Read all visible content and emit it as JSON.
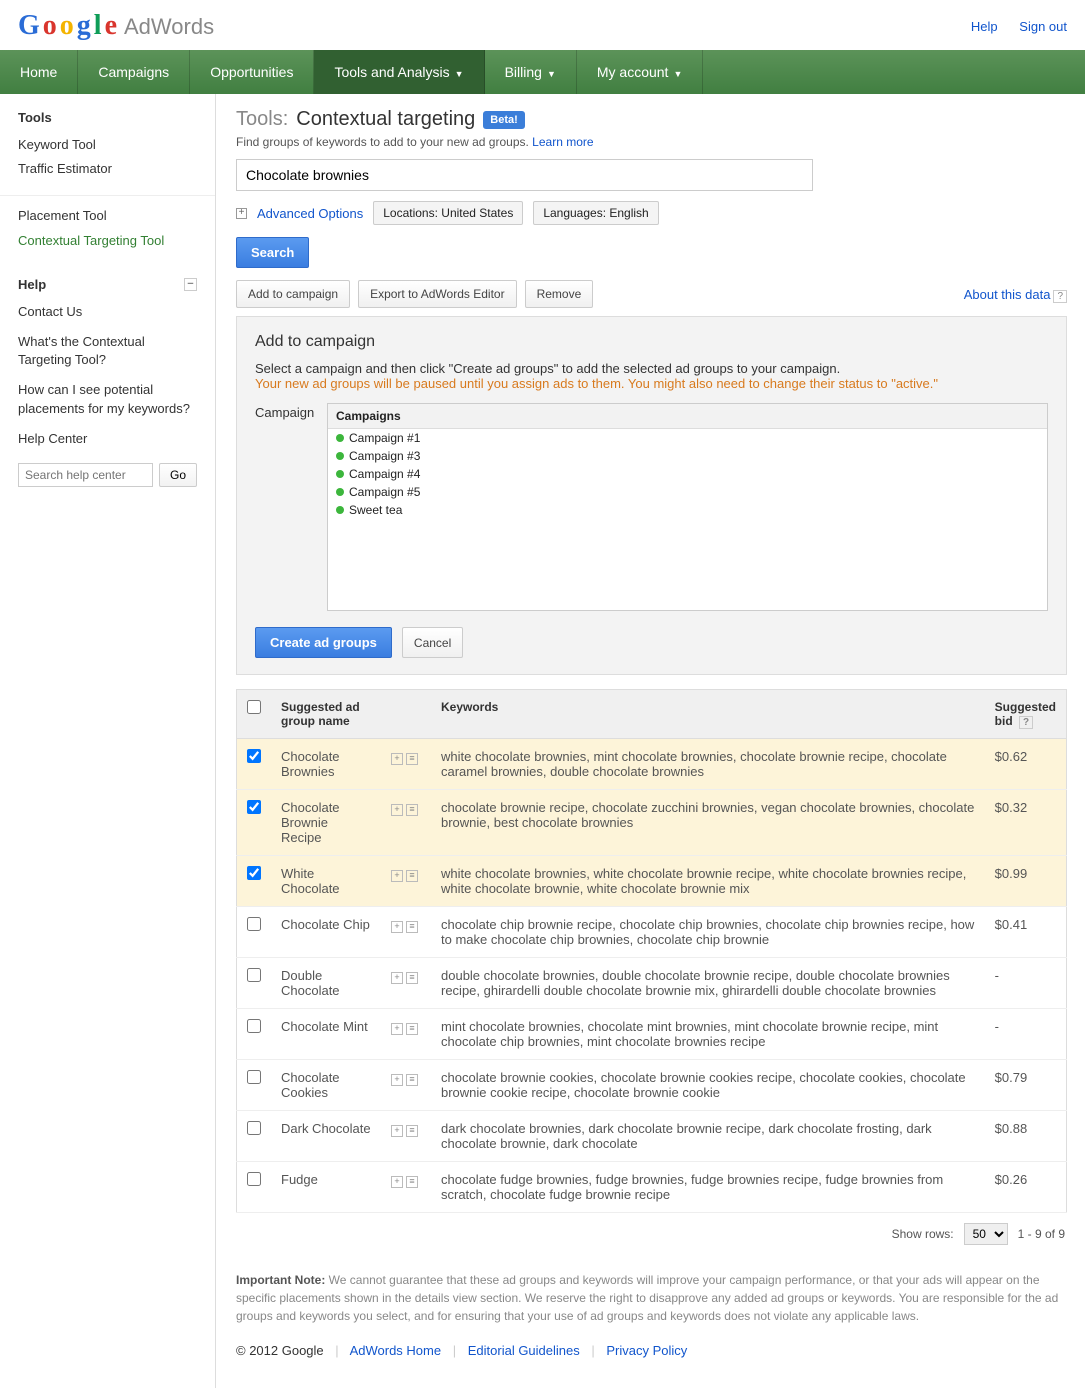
{
  "header": {
    "brand_product": "AdWords",
    "links": {
      "help": "Help",
      "signout": "Sign out"
    }
  },
  "nav": {
    "home": "Home",
    "campaigns": "Campaigns",
    "opportunities": "Opportunities",
    "tools": "Tools and Analysis",
    "billing": "Billing",
    "account": "My account"
  },
  "sidebar": {
    "tools_heading": "Tools",
    "keyword_tool": "Keyword Tool",
    "traffic_estimator": "Traffic Estimator",
    "placement_tool": "Placement Tool",
    "contextual_tool": "Contextual Targeting Tool",
    "help_heading": "Help",
    "contact": "Contact Us",
    "what_is": "What's the Contextual Targeting Tool?",
    "placements": "How can I see potential placements for my keywords?",
    "help_center": "Help Center",
    "search_placeholder": "Search help center",
    "go": "Go"
  },
  "page": {
    "tools_label": "Tools:",
    "title": "Contextual targeting",
    "beta": "Beta!",
    "subtitle_text": "Find groups of keywords to add to your new ad groups. ",
    "learn_more": "Learn more",
    "search_value": "Chocolate brownies",
    "advanced": "Advanced Options",
    "locations": "Locations: United States",
    "languages": "Languages: English",
    "search_btn": "Search",
    "add_campaign_btn": "Add to campaign",
    "export_btn": "Export to AdWords Editor",
    "remove_btn": "Remove",
    "about_data": "About this data"
  },
  "panel": {
    "title": "Add to campaign",
    "desc": "Select a campaign and then click \"Create ad groups\" to add the selected ad groups to your campaign.",
    "warn": "Your new ad groups will be paused until you assign ads to them. You might also need to change their status to \"active.\"",
    "campaign_label": "Campaign",
    "campaigns_header": "Campaigns",
    "campaigns": [
      "Campaign #1",
      "Campaign #3",
      "Campaign #4",
      "Campaign #5",
      "Sweet tea"
    ],
    "create_btn": "Create ad groups",
    "cancel_btn": "Cancel"
  },
  "table": {
    "col_name": "Suggested ad group name",
    "col_keywords": "Keywords",
    "col_bid": "Suggested bid",
    "rows": [
      {
        "checked": true,
        "name": "Chocolate Brownies",
        "keywords": "white chocolate brownies, mint chocolate brownies, chocolate brownie recipe, chocolate caramel brownies, double chocolate brownies",
        "bid": "$0.62"
      },
      {
        "checked": true,
        "name": "Chocolate Brownie Recipe",
        "keywords": "chocolate brownie recipe, chocolate zucchini brownies, vegan chocolate brownies, chocolate brownie, best chocolate brownies",
        "bid": "$0.32"
      },
      {
        "checked": true,
        "name": "White Chocolate",
        "keywords": "white chocolate brownies, white chocolate brownie recipe, white chocolate brownies recipe, white chocolate brownie, white chocolate brownie mix",
        "bid": "$0.99"
      },
      {
        "checked": false,
        "name": "Chocolate Chip",
        "keywords": "chocolate chip brownie recipe, chocolate chip brownies, chocolate chip brownies recipe, how to make chocolate chip brownies, chocolate chip brownie",
        "bid": "$0.41"
      },
      {
        "checked": false,
        "name": "Double Chocolate",
        "keywords": "double chocolate brownies, double chocolate brownie recipe, double chocolate brownies recipe, ghirardelli double chocolate brownie mix, ghirardelli double chocolate brownies",
        "bid": "-"
      },
      {
        "checked": false,
        "name": "Chocolate Mint",
        "keywords": "mint chocolate brownies, chocolate mint brownies, mint chocolate brownie recipe, mint chocolate chip brownies, mint chocolate brownies recipe",
        "bid": "-"
      },
      {
        "checked": false,
        "name": "Chocolate Cookies",
        "keywords": "chocolate brownie cookies, chocolate brownie cookies recipe, chocolate cookies, chocolate brownie cookie recipe, chocolate brownie cookie",
        "bid": "$0.79"
      },
      {
        "checked": false,
        "name": "Dark Chocolate",
        "keywords": "dark chocolate brownies, dark chocolate brownie recipe, dark chocolate frosting, dark chocolate brownie, dark chocolate",
        "bid": "$0.88"
      },
      {
        "checked": false,
        "name": "Fudge",
        "keywords": "chocolate fudge brownies, fudge brownies, fudge brownies recipe, fudge brownies from scratch, chocolate fudge brownie recipe",
        "bid": "$0.26"
      }
    ]
  },
  "pager": {
    "show_rows": "Show rows:",
    "rows_value": "50",
    "range": "1 - 9 of 9"
  },
  "note": {
    "label": "Important Note:",
    "text": " We cannot guarantee that these ad groups and keywords will improve your campaign performance, or that your ads will appear on the specific placements shown in the details view section. We reserve the right to disapprove any added ad groups or keywords. You are responsible for the ad groups and keywords you select, and for ensuring that your use of ad groups and keywords does not violate any applicable laws."
  },
  "footer": {
    "copyright": "© 2012 Google",
    "adwords_home": "AdWords Home",
    "editorial": "Editorial Guidelines",
    "privacy": "Privacy Policy"
  }
}
